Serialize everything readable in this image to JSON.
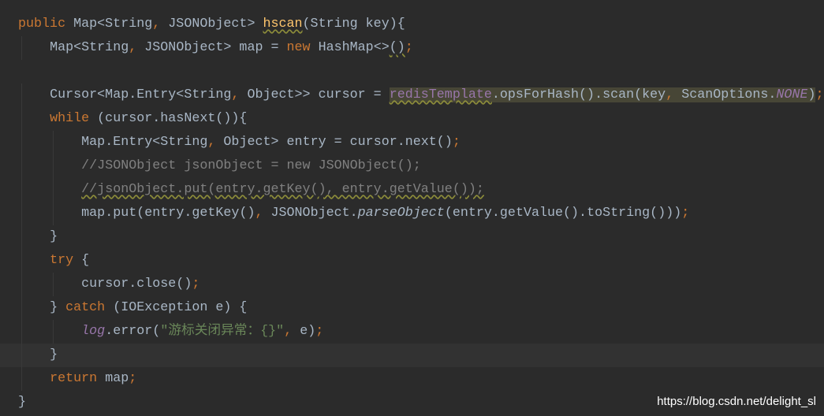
{
  "editor": {
    "theme_colors": {
      "background": "#2b2b2b",
      "keyword": "#cc7832",
      "text": "#a9b7c6",
      "field": "#9876aa",
      "method": "#ffc66d",
      "comment": "#808080",
      "string": "#6a8759"
    },
    "current_line": 15,
    "lines": [
      {
        "indent": 0,
        "tokens": [
          [
            "public ",
            "kw"
          ],
          [
            "Map<String",
            "plain"
          ],
          [
            ", ",
            "punct"
          ],
          [
            "JSONObject> ",
            "plain"
          ],
          [
            "hscan",
            "method wavy"
          ],
          [
            "(String key){",
            "plain"
          ]
        ]
      },
      {
        "indent": 1,
        "tokens": [
          [
            "Map<String",
            "plain"
          ],
          [
            ", ",
            "punct"
          ],
          [
            "JSONObject> map = ",
            "plain"
          ],
          [
            "new ",
            "kw"
          ],
          [
            "HashMap<>",
            "plain"
          ],
          [
            "()",
            "plain wavy"
          ],
          [
            ";",
            "punct"
          ]
        ]
      },
      {
        "indent": 0,
        "tokens": []
      },
      {
        "indent": 1,
        "tokens": [
          [
            "Cursor<Map.Entry<String",
            "plain"
          ],
          [
            ", ",
            "punct"
          ],
          [
            "Object>> cursor = ",
            "plain"
          ],
          [
            "redisTemplate",
            "field hl wavy"
          ],
          [
            ".opsForHash().scan(key",
            "plain hl"
          ],
          [
            ", ",
            "punct hl"
          ],
          [
            "ScanOptions.",
            "plain hl"
          ],
          [
            "NONE",
            "static hl"
          ],
          [
            ")",
            "plain hl"
          ],
          [
            ";",
            "punct"
          ]
        ]
      },
      {
        "indent": 1,
        "tokens": [
          [
            "while ",
            "kw"
          ],
          [
            "(cursor.hasNext()){",
            "plain"
          ]
        ]
      },
      {
        "indent": 2,
        "tokens": [
          [
            "Map.Entry<String",
            "plain"
          ],
          [
            ", ",
            "punct"
          ],
          [
            "Object> entry = cursor.next()",
            "plain"
          ],
          [
            ";",
            "punct"
          ]
        ]
      },
      {
        "indent": 2,
        "tokens": [
          [
            "//JSONObject jsonObject = new JSONObject();",
            "comment"
          ]
        ]
      },
      {
        "indent": 2,
        "tokens": [
          [
            "//jsonObject.put(entry.getKey(), entry.getValue());",
            "comment wavy"
          ]
        ]
      },
      {
        "indent": 2,
        "tokens": [
          [
            "map.put(entry.getKey()",
            "plain"
          ],
          [
            ", ",
            "punct"
          ],
          [
            "JSONObject.",
            "plain"
          ],
          [
            "parseObject",
            "italic"
          ],
          [
            "(entry.getValue().toString()))",
            "plain"
          ],
          [
            ";",
            "punct"
          ]
        ]
      },
      {
        "indent": 1,
        "tokens": [
          [
            "}",
            "plain"
          ]
        ]
      },
      {
        "indent": 1,
        "tokens": [
          [
            "try ",
            "kw"
          ],
          [
            "{",
            "plain"
          ]
        ]
      },
      {
        "indent": 2,
        "tokens": [
          [
            "cursor.close()",
            "plain"
          ],
          [
            ";",
            "punct"
          ]
        ]
      },
      {
        "indent": 1,
        "tokens": [
          [
            "} ",
            "plain"
          ],
          [
            "catch ",
            "kw"
          ],
          [
            "(IOException e) {",
            "plain"
          ]
        ]
      },
      {
        "indent": 2,
        "tokens": [
          [
            "log",
            "static"
          ],
          [
            ".error(",
            "plain"
          ],
          [
            "\"游标关闭异常：{}\"",
            "string"
          ],
          [
            ", ",
            "punct"
          ],
          [
            "e)",
            "plain"
          ],
          [
            ";",
            "punct"
          ]
        ]
      },
      {
        "indent": 1,
        "tokens": [
          [
            "}",
            "plain"
          ]
        ]
      },
      {
        "indent": 1,
        "tokens": [
          [
            "return ",
            "kw"
          ],
          [
            "map",
            "plain"
          ],
          [
            ";",
            "punct"
          ]
        ]
      },
      {
        "indent": 0,
        "tokens": [
          [
            "}",
            "plain"
          ]
        ]
      }
    ]
  },
  "watermark": "https://blog.csdn.net/delight_sl"
}
